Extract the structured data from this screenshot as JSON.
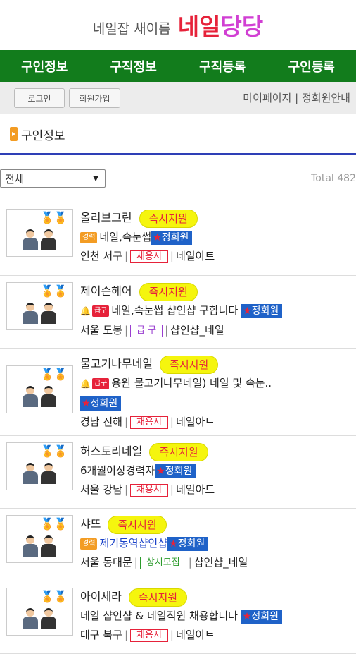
{
  "brand": {
    "subtitle": "네일잡 새이름",
    "name_part1": "네일",
    "name_part2": "당당",
    "color1": "#e6223a",
    "color2": "#d13fd3"
  },
  "nav": {
    "items": [
      "구인정보",
      "구직정보",
      "구직등록",
      "구인등록"
    ],
    "bg_color": "#127c1c"
  },
  "subnav": {
    "login": "로그인",
    "signup": "회원가입",
    "mypage": "마이페이지",
    "separator": "|",
    "membership": "정회원안내"
  },
  "section": {
    "title": "구인정보"
  },
  "filter": {
    "selected": "전체",
    "total": "Total 482"
  },
  "jobs": [
    {
      "name": "올리브그린",
      "urgent": "즉시지원",
      "tag": "경력",
      "desc": "네일,속눈썹",
      "vip": "정회원",
      "location": "인천 서구",
      "hire": "채용시",
      "category": "네일아트"
    },
    {
      "name": "제이슨헤어",
      "urgent": "즉시지원",
      "tag": "급구",
      "desc": "네일,속눈썹 샵인샵 구합니다",
      "vip": "정회원",
      "location": "서울 도봉",
      "hire": "급 구",
      "category": "샵인샵_네일"
    },
    {
      "name": "물고기나무네일",
      "urgent": "즉시지원",
      "tag": "급구",
      "desc": "용원 물고기나무네일) 네일 및 속눈..",
      "vip": "정회원",
      "location": "경남 진해",
      "hire": "채용시",
      "category": "네일아트"
    },
    {
      "name": "허스토리네일",
      "urgent": "즉시지원",
      "desc": "6개월이상경력자",
      "vip": "정회원",
      "location": "서울 강남",
      "hire": "채용시",
      "category": "네일아트"
    },
    {
      "name": "샤뜨",
      "urgent": "즉시지원",
      "tag": "경력",
      "desc": "제기동역샵인샵",
      "vip": "정회원",
      "location": "서울 동대문",
      "hire": "상시모집",
      "category": "샵인샵_네일"
    },
    {
      "name": "아이세라",
      "urgent": "즉시지원",
      "desc": "네일 샵인샵 & 네일직원 채용합니다",
      "vip": "정회원",
      "location": "대구 북구",
      "hire": "채용시",
      "category": "네일아트"
    }
  ]
}
